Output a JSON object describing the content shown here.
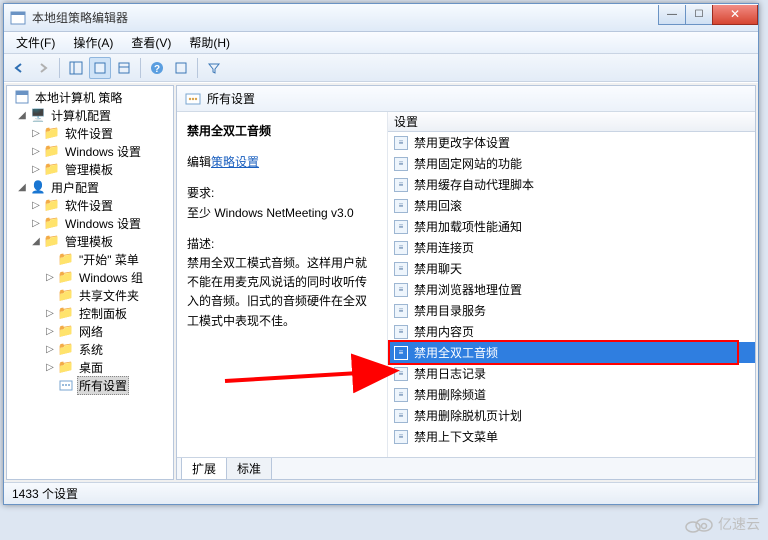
{
  "window": {
    "title": "本地组策略编辑器"
  },
  "menu": {
    "file": "文件(F)",
    "action": "操作(A)",
    "view": "查看(V)",
    "help": "帮助(H)"
  },
  "tree": {
    "root": "本地计算机 策略",
    "computer_config": "计算机配置",
    "software_settings": "软件设置",
    "windows_settings": "Windows 设置",
    "admin_templates": "管理模板",
    "user_config": "用户配置",
    "start_menu": "\"开始\" 菜单",
    "windows_components": "Windows 组",
    "shared_folders": "共享文件夹",
    "control_panel": "控制面板",
    "network": "网络",
    "system": "系统",
    "desktop": "桌面",
    "all_settings": "所有设置"
  },
  "header": {
    "title": "所有设置"
  },
  "detail": {
    "title": "禁用全双工音频",
    "edit_prefix": "编辑",
    "edit_link": "策略设置",
    "req_label": "要求:",
    "req_value": "至少 Windows NetMeeting v3.0",
    "desc_label": "描述:",
    "desc_body": "禁用全双工模式音频。这样用户就不能在用麦克风说话的同时收听传入的音频。旧式的音频硬件在全双工模式中表现不佳。"
  },
  "list": {
    "column": "设置",
    "items": [
      "禁用更改字体设置",
      "禁用固定网站的功能",
      "禁用缓存自动代理脚本",
      "禁用回滚",
      "禁用加载项性能通知",
      "禁用连接页",
      "禁用聊天",
      "禁用浏览器地理位置",
      "禁用目录服务",
      "禁用内容页",
      "禁用全双工音频",
      "禁用日志记录",
      "禁用删除频道",
      "禁用删除脱机页计划",
      "禁用上下文菜单"
    ],
    "selected_index": 10
  },
  "tabs": {
    "extended": "扩展",
    "standard": "标准"
  },
  "status": {
    "text": "1433 个设置"
  },
  "watermark": {
    "text": "亿速云"
  }
}
